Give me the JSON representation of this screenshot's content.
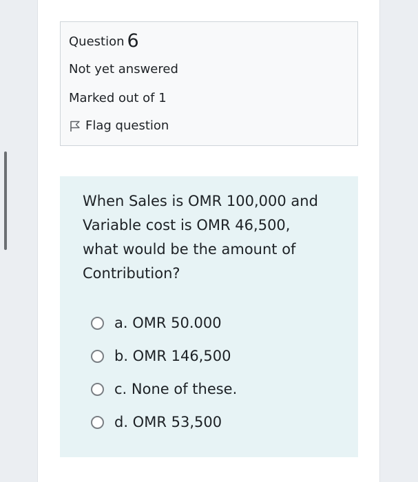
{
  "question_info": {
    "label": "Question",
    "number": "6",
    "state": "Not yet answered",
    "grade": "Marked out of 1",
    "flag_label": "Flag question",
    "flag_icon": "flag-icon"
  },
  "question": {
    "text": "When Sales is OMR 100,000 and Variable cost is OMR 46,500, what would be the amount of Contribution?",
    "answers": [
      {
        "label": "a. OMR 50.000"
      },
      {
        "label": "b. OMR 146,500"
      },
      {
        "label": "c. None of these."
      },
      {
        "label": "d. OMR 53,500"
      }
    ]
  }
}
